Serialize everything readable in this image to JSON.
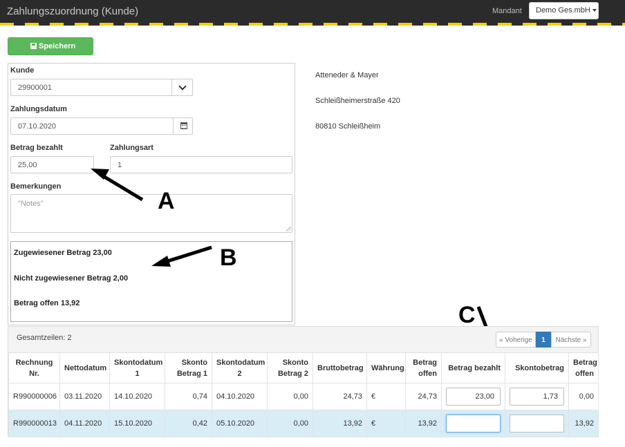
{
  "header": {
    "title": "Zahlungszuordnung (Kunde)",
    "mandant_label": "Mandant",
    "mandant_value": "Demo Ges.mbH"
  },
  "toolbar": {
    "save_label": "Speichern",
    "save_icon": "floppy-disk-icon"
  },
  "form": {
    "kunde_label": "Kunde",
    "kunde_value": "29900001",
    "datum_label": "Zahlungsdatum",
    "datum_value": "07.10.2020",
    "betrag_label": "Betrag bezahlt",
    "betrag_value": "25,00",
    "zahlungsart_label": "Zahlungsart",
    "zahlungsart_value": "1",
    "bemerkungen_label": "Bemerkungen",
    "bemerkungen_placeholder": "\"Notes\""
  },
  "summary": {
    "zugewiesen": "Zugewiesener Betrag 23,00",
    "nicht_zugewiesen": "Nicht zugewiesener Betrag 2,00",
    "offen": "Betrag offen 13,92"
  },
  "address": {
    "name": "Atteneder & Mayer",
    "street": "Schleißheimerstraße 420",
    "city": "80810 Schleißheim"
  },
  "annotations": {
    "a": "A",
    "b": "B",
    "c": "C"
  },
  "grid": {
    "total_label": "Gesamtzeilen: 2",
    "pager": {
      "prev": "« Voherige",
      "current": "1",
      "next": "Nächste »"
    },
    "columns": [
      "Rechnung Nr.",
      "Nettodatum",
      "Skontodatum 1",
      "Skonto Betrag 1",
      "Skontodatum 2",
      "Skonto Betrag 2",
      "Bruttobetrag",
      "Währung",
      "Betrag offen",
      "Betrag bezahlt",
      "Skontobetrag",
      "Betrag offen"
    ],
    "rows": [
      {
        "rechnung": "R990000006",
        "nettodatum": "03.11.2020",
        "skontodatum1": "14.10.2020",
        "skonto1": "0,74",
        "skontodatum2": "04.10.2020",
        "skonto2": "0,00",
        "brutto": "24,73",
        "waehrung": "€",
        "offen": "24,73",
        "bezahlt": "23,00",
        "skontobetrag": "1,73",
        "offen_rest": "0,00"
      },
      {
        "rechnung": "R990000013",
        "nettodatum": "04.11.2020",
        "skontodatum1": "15.10.2020",
        "skonto1": "0,42",
        "skontodatum2": "05.10.2020",
        "skonto2": "0,00",
        "brutto": "13,92",
        "waehrung": "€",
        "offen": "13,92",
        "bezahlt": "",
        "skontobetrag": "",
        "offen_rest": "13,92"
      }
    ]
  }
}
